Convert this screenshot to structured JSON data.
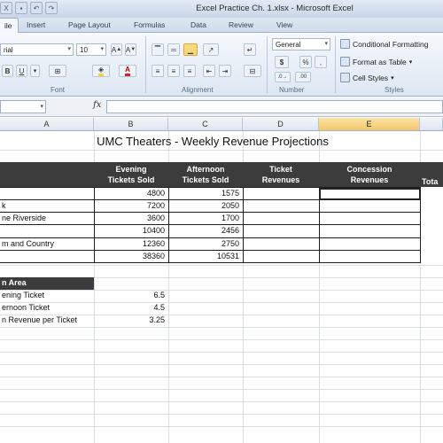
{
  "window": {
    "title": "Excel Practice Ch. 1.xlsx - Microsoft Excel"
  },
  "tabs": [
    {
      "label": "ile"
    },
    {
      "label": "Insert"
    },
    {
      "label": "Page Layout"
    },
    {
      "label": "Formulas"
    },
    {
      "label": "Data"
    },
    {
      "label": "Review"
    },
    {
      "label": "View"
    }
  ],
  "ribbon": {
    "font_name": "rial",
    "font_size": "10",
    "number_format": "General",
    "groups": {
      "font": "Font",
      "alignment": "Alignment",
      "number": "Number",
      "styles": "Styles"
    },
    "styles": {
      "conditional": "Conditional Formatting",
      "format_table": "Format as Table",
      "cell_styles": "Cell Styles"
    },
    "bold": "B",
    "underline": "U",
    "dollar": "$",
    "percent": "%"
  },
  "formula_bar": {
    "fx": "fx",
    "name_box": "",
    "content": ""
  },
  "columns": [
    "A",
    "B",
    "C",
    "D",
    "E"
  ],
  "sheet": {
    "title": "UMC Theaters - Weekly Revenue Projections",
    "headers": {
      "evening": [
        "Evening",
        "Tickets Sold"
      ],
      "afternoon": [
        "Afternoon",
        "Tickets Sold"
      ],
      "ticket_rev": [
        "Ticket",
        "Revenues"
      ],
      "concession": [
        "Concession",
        "Revenues"
      ],
      "total": "Tota"
    },
    "rows": [
      {
        "name": "",
        "evening": "4800",
        "afternoon": "1575"
      },
      {
        "name": "k",
        "evening": "7200",
        "afternoon": "2050"
      },
      {
        "name": "ne Riverside",
        "evening": "3600",
        "afternoon": "1700"
      },
      {
        "name": "",
        "evening": "10400",
        "afternoon": "2456"
      },
      {
        "name": "m and Country",
        "evening": "12360",
        "afternoon": "2750"
      },
      {
        "name": "",
        "evening": "38360",
        "afternoon": "10531"
      }
    ],
    "input_area": {
      "title": "n Area",
      "items": [
        {
          "label": "ening Ticket",
          "value": "6.5"
        },
        {
          "label": "ernoon Ticket",
          "value": "4.5"
        },
        {
          "label": "n Revenue per Ticket",
          "value": "3.25"
        }
      ]
    }
  }
}
